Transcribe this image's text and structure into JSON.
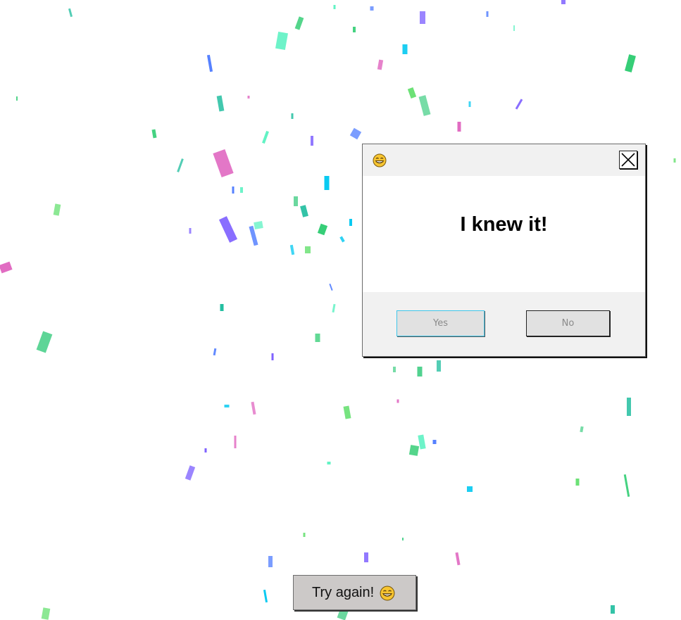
{
  "dialog": {
    "title_icon": "grinning-face-icon",
    "close_icon": "close-icon",
    "message": "I knew it!",
    "yes_label": "Yes",
    "no_label": "No"
  },
  "try_again": {
    "label": "Try again!",
    "icon": "grinning-face-icon"
  },
  "background": {
    "effect": "confetti",
    "colors": [
      "#1abc9c",
      "#2ecc71",
      "#5cf2c2",
      "#4f7cff",
      "#7a5cff",
      "#e066c0",
      "#00c8f0",
      "#66e070",
      "#4ad08a"
    ]
  }
}
